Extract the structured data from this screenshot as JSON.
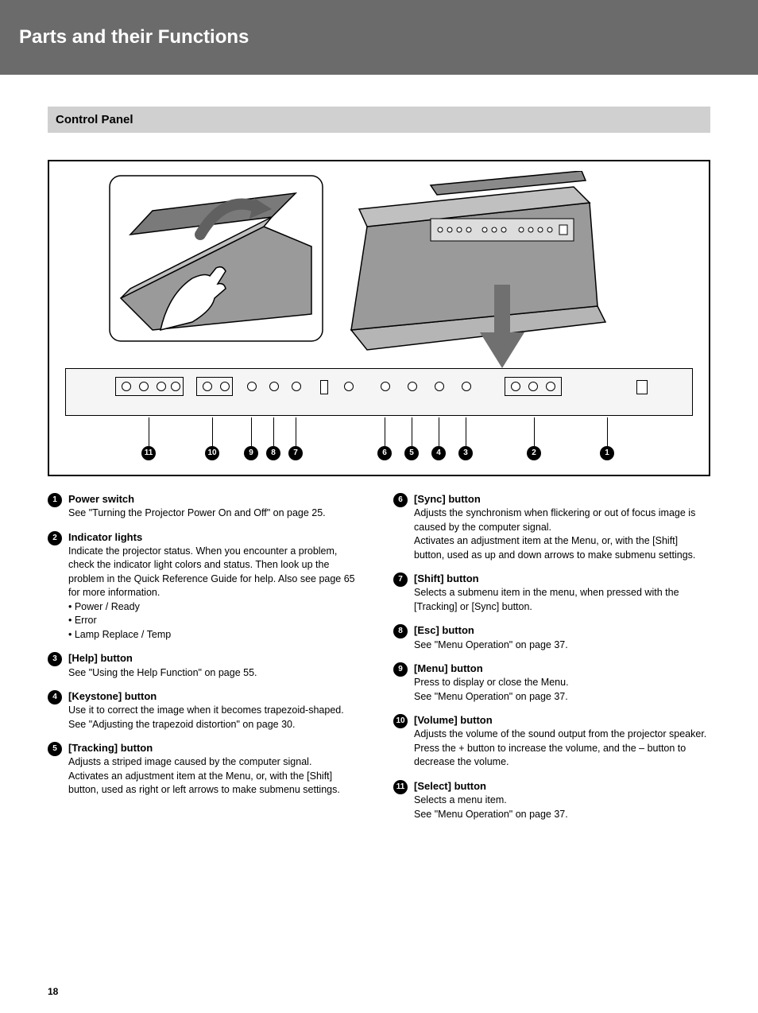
{
  "header": {
    "title": "Parts and their Functions"
  },
  "section": {
    "title": "Control Panel"
  },
  "diagram": {
    "callouts": [
      "1",
      "2",
      "3",
      "4",
      "5",
      "6",
      "7",
      "8",
      "9",
      "10",
      "11"
    ]
  },
  "left_items": [
    {
      "num": "1",
      "title": "Power switch",
      "desc": "See \"Turning the Projector Power On and Off\" on page 25."
    },
    {
      "num": "2",
      "title": "Indicator lights",
      "desc": "Indicate the projector status. When you encounter a problem, check the indicator light colors and status. Then look up the problem in the Quick Reference Guide for help. Also see page 65 for more information.\n• Power / Ready\n• Error\n• Lamp Replace / Temp"
    },
    {
      "num": "3",
      "title": "[Help] button",
      "desc": "See \"Using the Help Function\" on page 55."
    },
    {
      "num": "4",
      "title": "[Keystone] button",
      "desc": "Use it to correct the image when it becomes trapezoid-shaped.\nSee \"Adjusting the trapezoid distortion\" on page 30."
    },
    {
      "num": "5",
      "title": "[Tracking] button",
      "desc": "Adjusts a striped image caused by the computer signal.\nActivates an adjustment item at the Menu, or, with the [Shift] button, used as right or left arrows to make submenu settings."
    }
  ],
  "right_items": [
    {
      "num": "6",
      "title": "[Sync] button",
      "desc": "Adjusts the synchronism when flickering or out of focus image is caused by the computer signal.\nActivates an adjustment item at the Menu, or, with the [Shift] button, used as up and down arrows to make submenu settings."
    },
    {
      "num": "7",
      "title": "[Shift] button",
      "desc": "Selects a submenu item in the menu, when pressed with the [Tracking] or [Sync] button."
    },
    {
      "num": "8",
      "title": "[Esc] button",
      "desc": "See \"Menu Operation\" on page 37."
    },
    {
      "num": "9",
      "title": "[Menu] button",
      "desc": "Press to display or close the Menu.\nSee \"Menu Operation\" on page 37."
    },
    {
      "num": "10",
      "title": "[Volume] button",
      "desc": "Adjusts the volume of the sound output from the projector speaker. Press the + button to increase the volume, and the – button to decrease the volume."
    },
    {
      "num": "11",
      "title": "[Select] button",
      "desc": "Selects a menu item.\nSee \"Menu Operation\" on page 37."
    }
  ],
  "page_number": "18"
}
